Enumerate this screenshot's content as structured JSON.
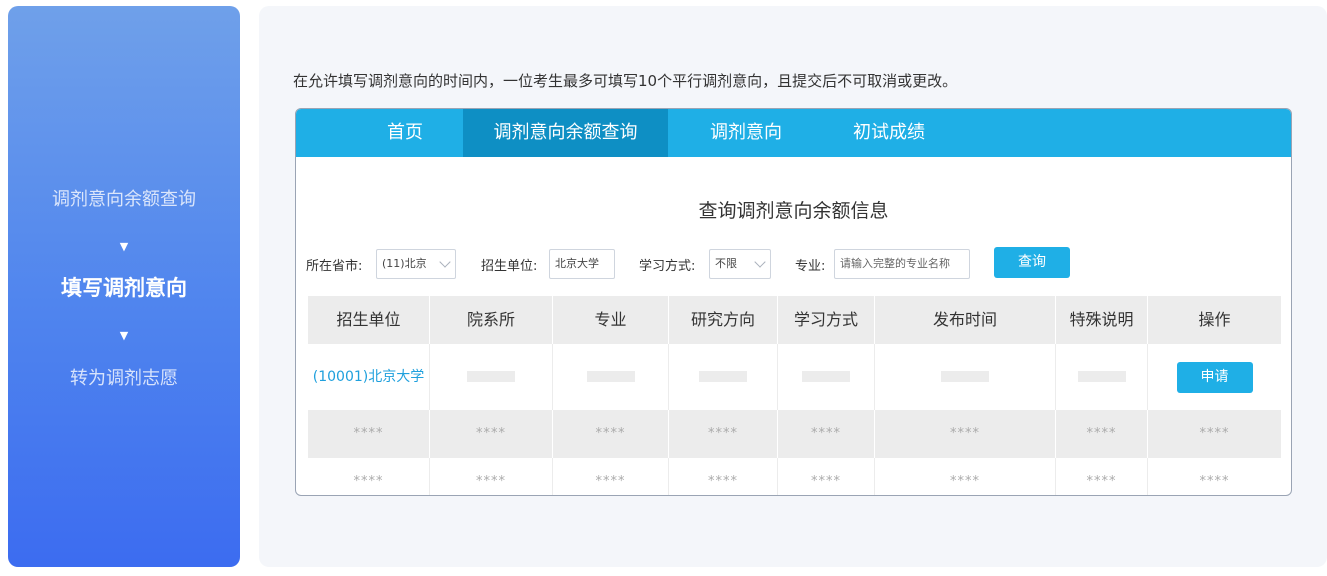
{
  "steps": {
    "step1": "调剂意向余额查询",
    "step2": "填写调剂意向",
    "step3": "转为调剂志愿",
    "arrow": "▼"
  },
  "notice": "在允许填写调剂意向的时间内，一位考生最多可填写10个平行调剂意向，且提交后不可取消或更改。",
  "nav": {
    "home": "首页",
    "query": "调剂意向余额查询",
    "intent": "调剂意向",
    "score": "初试成绩"
  },
  "frame_title": "查询调剂意向余额信息",
  "filters": {
    "province_label": "所在省市:",
    "province_value": "(11)北京",
    "unit_label": "招生单位:",
    "unit_value": "北京大学",
    "mode_label": "学习方式:",
    "mode_value": "不限",
    "major_label": "专业:",
    "major_placeholder": "请输入完整的专业名称",
    "query_button": "查询"
  },
  "table": {
    "headers": [
      "招生单位",
      "院系所",
      "专业",
      "研究方向",
      "学习方式",
      "发布时间",
      "特殊说明",
      "操作"
    ],
    "row1": {
      "unit": "(10001)北京大学",
      "action": "申请"
    },
    "masked": "****"
  },
  "colors": {
    "accent": "#1fafe6",
    "nav_active": "#0e8fc4",
    "panel_gradient_top": "#6fa0ea",
    "panel_gradient_bottom": "#3c6cf0"
  }
}
